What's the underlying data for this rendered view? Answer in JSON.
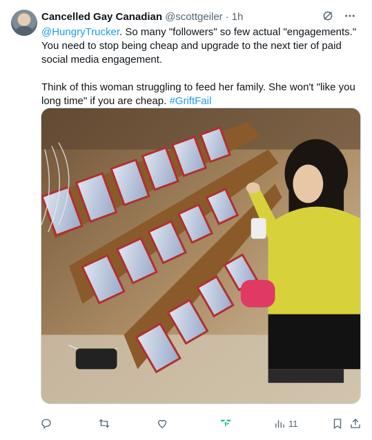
{
  "tweet": {
    "author_name": "Cancelled Gay Canadian",
    "handle": "@scottgeiler",
    "separator": "·",
    "time": "1h",
    "mention": "@HungryTrucker",
    "text_part1": ". So many \"followers\" so few actual \"engagements.\" You need to stop being cheap and upgrade to the next tier of paid social media engagement.",
    "text_part2": "Think of this woman struggling to feed her family.  She won't \"like you long time\" if you are cheap.",
    "hashtag": "#GriftFail"
  },
  "actions": {
    "reply": {
      "icon": "reply-icon",
      "count": ""
    },
    "retweet": {
      "icon": "retweet-icon",
      "count": ""
    },
    "like": {
      "icon": "like-icon",
      "count": ""
    },
    "grok": {
      "icon": "grok-analyze-icon"
    },
    "views": {
      "icon": "views-icon",
      "count": "11"
    },
    "bookmark": {
      "icon": "bookmark-icon"
    },
    "share": {
      "icon": "share-icon"
    }
  },
  "colors": {
    "text": "#0f1419",
    "secondary": "#536471",
    "link": "#1d9bf0",
    "border": "#cfd9de",
    "grok_accent": "#00ba7c"
  }
}
